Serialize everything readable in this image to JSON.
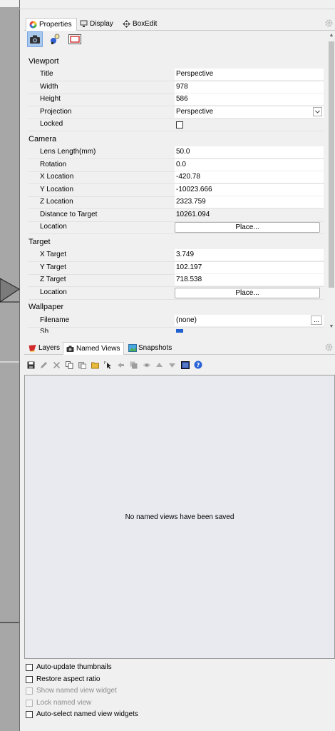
{
  "properties_tabs": [
    {
      "label": "Properties",
      "icon": "color-wheel-icon"
    },
    {
      "label": "Display",
      "icon": "monitor-icon"
    },
    {
      "label": "BoxEdit",
      "icon": "move-arrows-icon"
    }
  ],
  "property_icons": [
    "camera-icon",
    "light-icon",
    "rectangle-frame-icon"
  ],
  "sections": {
    "viewport": "Viewport",
    "camera": "Camera",
    "target": "Target",
    "wallpaper": "Wallpaper"
  },
  "viewport": {
    "title_label": "Title",
    "title_value": "Perspective",
    "width_label": "Width",
    "width_value": "978",
    "height_label": "Height",
    "height_value": "586",
    "projection_label": "Projection",
    "projection_value": "Perspective",
    "locked_label": "Locked",
    "locked_checked": false
  },
  "camera": {
    "lens_label": "Lens Length(mm)",
    "lens_value": "50.0",
    "rotation_label": "Rotation",
    "rotation_value": "0.0",
    "xloc_label": "X Location",
    "xloc_value": "-420.78",
    "yloc_label": "Y Location",
    "yloc_value": "-10023.666",
    "zloc_label": "Z Location",
    "zloc_value": "2323.759",
    "dist_label": "Distance to Target",
    "dist_value": "10261.094",
    "location_label": "Location",
    "place_button": "Place..."
  },
  "target": {
    "xt_label": "X Target",
    "xt_value": "3.749",
    "yt_label": "Y Target",
    "yt_value": "102.197",
    "zt_label": "Z Target",
    "zt_value": "718.538",
    "location_label": "Location",
    "place_button": "Place..."
  },
  "wallpaper": {
    "filename_label": "Filename",
    "filename_value": "(none)",
    "browse_button": "...",
    "show_label": "Sh"
  },
  "lower_tabs": [
    {
      "label": "Layers",
      "icon": "layers-icon"
    },
    {
      "label": "Named Views",
      "icon": "camera-icon"
    },
    {
      "label": "Snapshots",
      "icon": "snapshot-icon"
    }
  ],
  "toolbar_icons": [
    "save-icon",
    "edit-icon",
    "delete-icon",
    "copy-icon",
    "paste-icon",
    "open-folder-icon",
    "select-icon",
    "back-icon",
    "duplicate-icon",
    "eye-icon",
    "move-up-icon",
    "move-down-icon",
    "thumbnail-icon",
    "help-icon"
  ],
  "named_views": {
    "empty_message": "No named views have been saved"
  },
  "options": [
    {
      "label": "Auto-update thumbnails",
      "checked": false,
      "enabled": true
    },
    {
      "label": "Restore aspect ratio",
      "checked": false,
      "enabled": true
    },
    {
      "label": "Show named view widget",
      "checked": false,
      "enabled": false
    },
    {
      "label": "Lock named view",
      "checked": false,
      "enabled": false
    },
    {
      "label": "Auto-select named view widgets",
      "checked": false,
      "enabled": true
    }
  ]
}
